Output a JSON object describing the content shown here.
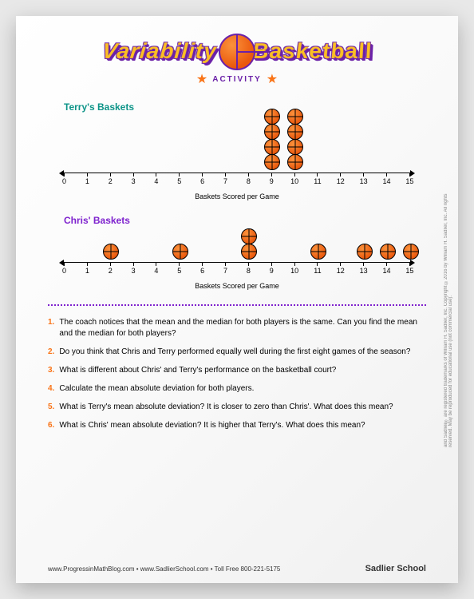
{
  "header": {
    "title": "Variability in Basketball",
    "activity_label": "ACTIVITY"
  },
  "chart_data": [
    {
      "type": "dotplot",
      "title": "Terry's Baskets",
      "xlabel": "Baskets Scored per Game",
      "xlim": [
        0,
        15
      ],
      "ticks": [
        0,
        1,
        2,
        3,
        4,
        5,
        6,
        7,
        8,
        9,
        10,
        11,
        12,
        13,
        14,
        15
      ],
      "values": [
        9,
        9,
        9,
        9,
        10,
        10,
        10,
        10
      ]
    },
    {
      "type": "dotplot",
      "title": "Chris' Baskets",
      "xlabel": "Baskets Scored per Game",
      "xlim": [
        0,
        15
      ],
      "ticks": [
        0,
        1,
        2,
        3,
        4,
        5,
        6,
        7,
        8,
        9,
        10,
        11,
        12,
        13,
        14,
        15
      ],
      "values": [
        2,
        5,
        8,
        8,
        11,
        13,
        14,
        15
      ]
    }
  ],
  "questions": [
    {
      "num": "1.",
      "text": "The coach notices that the mean and the median for both players is the same. Can you find the mean and the median for both players?"
    },
    {
      "num": "2.",
      "text": "Do you think that Chris and Terry performed equally well during the first eight games of the season?"
    },
    {
      "num": "3.",
      "text": "What is different about Chris' and Terry's performance on the basketball court?"
    },
    {
      "num": "4.",
      "text": "Calculate the mean absolute deviation for both players."
    },
    {
      "num": "5.",
      "text": "What is Terry's mean absolute deviation? It is closer to zero than Chris'. What does this mean?"
    },
    {
      "num": "6.",
      "text": "What is Chris' mean absolute deviation? It is higher that Terry's. What does this mean?"
    }
  ],
  "footer": {
    "left": "www.ProgressinMathBlog.com  •  www.SadlierSchool.com  •  Toll Free 800-221-5175",
    "right": "Sadlier School"
  },
  "side_copyright": "and Sadlier® are registered trademarks of William H. Sadlier, Inc.   Copyright ©2016 by William H. Sadlier, Inc. All rights reserved.   May be reproduced for educational use (not commercial use)."
}
